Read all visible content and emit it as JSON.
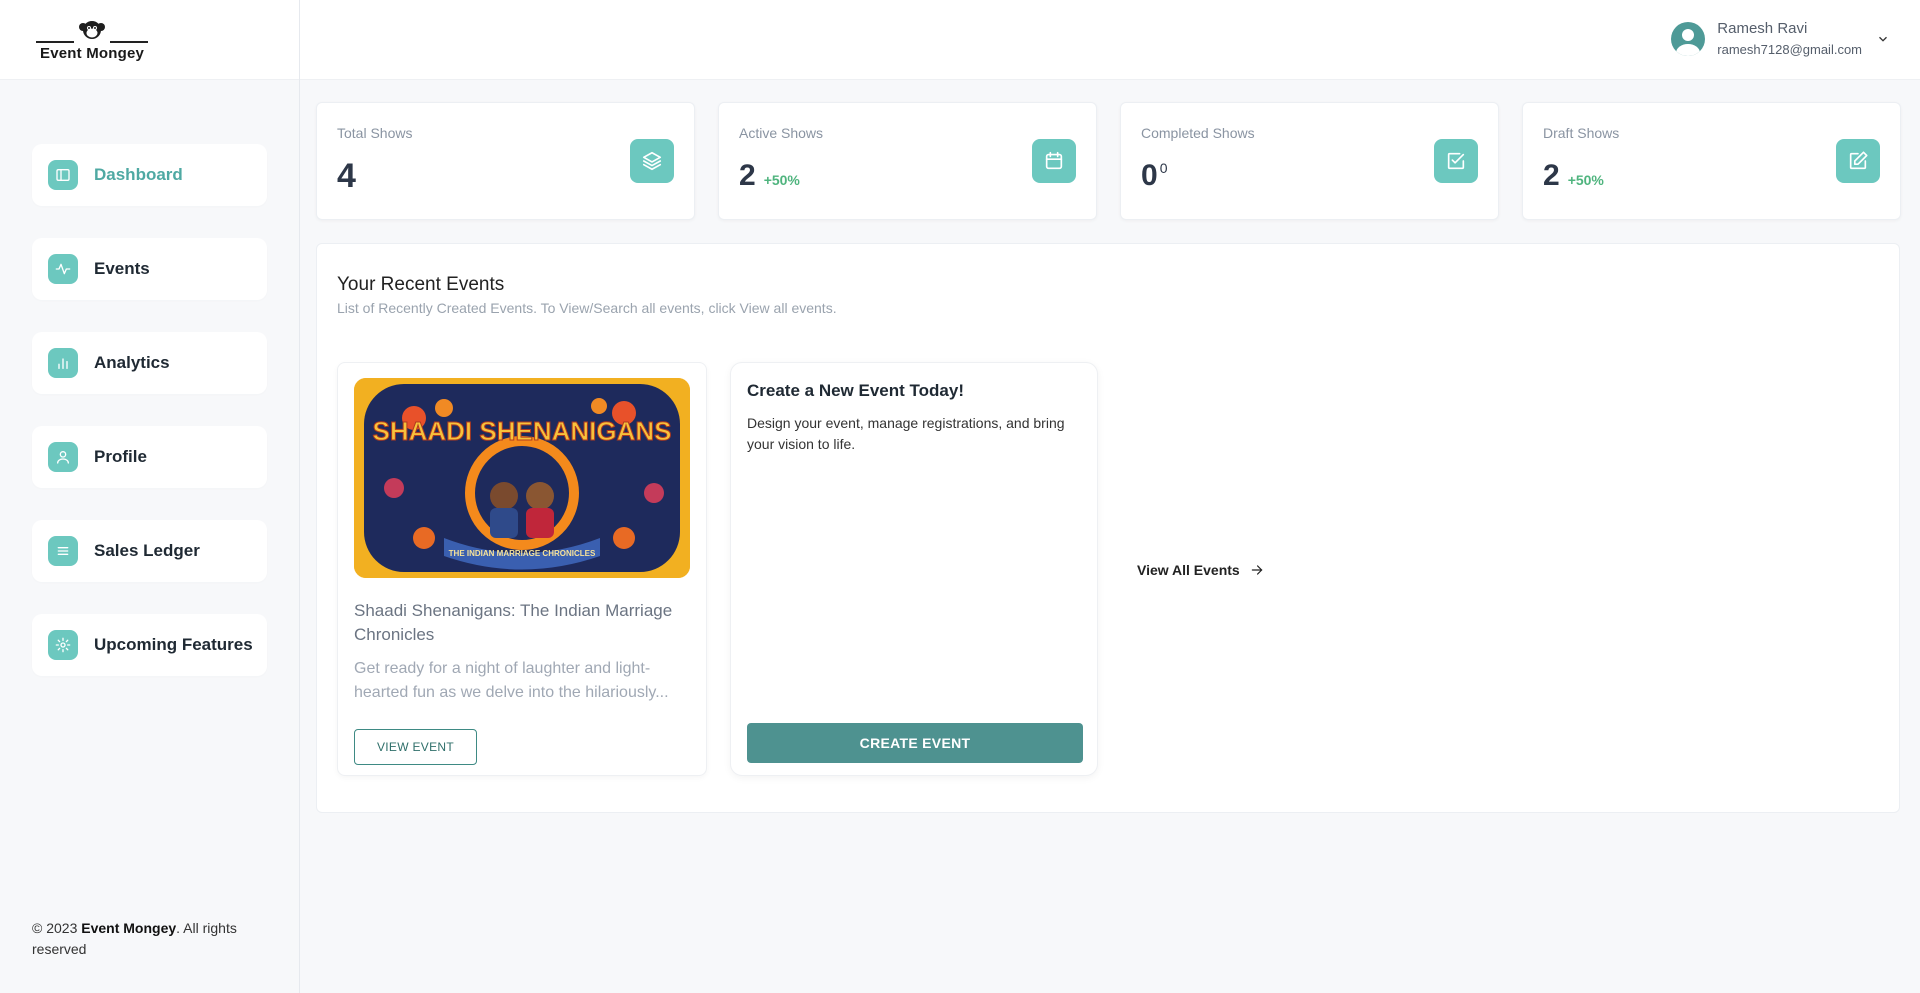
{
  "brand": {
    "name": "Event Mongey"
  },
  "sidebar": {
    "items": [
      {
        "label": "Dashboard",
        "icon": "dashboard-icon",
        "active": true
      },
      {
        "label": "Events",
        "icon": "activity-icon"
      },
      {
        "label": "Analytics",
        "icon": "bar-chart-icon"
      },
      {
        "label": "Profile",
        "icon": "user-icon"
      },
      {
        "label": "Sales Ledger",
        "icon": "list-icon"
      },
      {
        "label": "Upcoming Features",
        "icon": "gear-icon"
      }
    ]
  },
  "footer": {
    "prefix": "© 2023 ",
    "brand": "Event Mongey",
    "suffix": ". All rights reserved"
  },
  "user": {
    "name": "Ramesh Ravi",
    "email": "ramesh7128@gmail.com"
  },
  "stats": [
    {
      "label": "Total Shows",
      "value": "4",
      "delta": "",
      "icon": "layers-icon"
    },
    {
      "label": "Active Shows",
      "value": "2",
      "delta": "+50%",
      "icon": "calendar-icon"
    },
    {
      "label": "Completed Shows",
      "value": "0",
      "sup": "0",
      "icon": "check-square-icon"
    },
    {
      "label": "Draft Shows",
      "value": "2",
      "delta": "+50%",
      "icon": "edit-icon"
    }
  ],
  "recent": {
    "title": "Your Recent Events",
    "subtitle": "List of Recently Created Events. To View/Search all events, click View all events.",
    "event": {
      "poster_title": "SHAADI SHENANIGANS",
      "poster_tagline": "THE INDIAN MARRIAGE CHRONICLES",
      "title": "Shaadi Shenanigans: The Indian Marriage Chronicles",
      "description": "Get ready for a night of laughter and light-hearted fun as we delve into the hilariously...",
      "button": "VIEW EVENT"
    },
    "create": {
      "title": "Create a New Event Today!",
      "description": "Design your event, manage registrations, and bring your vision to life.",
      "button": "CREATE EVENT"
    },
    "view_all": "View All Events"
  },
  "colors": {
    "accent": "#6cc8bf",
    "primary": "#4e9290",
    "active_text": "#4fa9a3",
    "positive": "#4fb47e"
  }
}
